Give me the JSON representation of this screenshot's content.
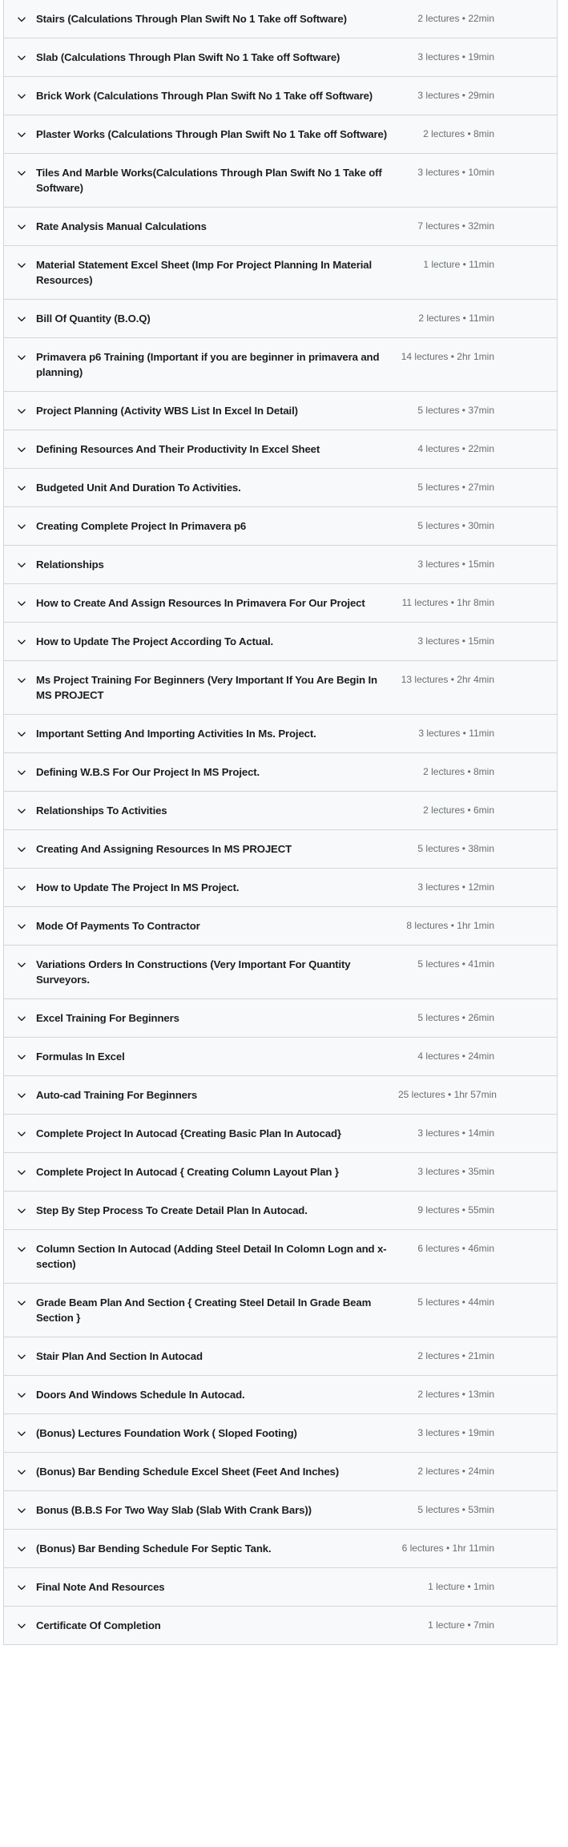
{
  "component": {
    "name": "course-curriculum-accordion",
    "colors": {
      "row_background": "#f7f9fa",
      "border": "#d1d7dc",
      "title_text": "#1c1d1f",
      "meta_text": "#6a6f73"
    },
    "chevron_icon": "chevron-down-icon"
  },
  "sections": [
    {
      "title": "Stairs (Calculations Through Plan Swift No 1 Take off Software)",
      "meta": "2 lectures • 22min"
    },
    {
      "title": "Slab (Calculations Through Plan Swift No 1 Take off Software)",
      "meta": "3 lectures • 19min"
    },
    {
      "title": "Brick Work (Calculations Through Plan Swift No 1 Take off Software)",
      "meta": "3 lectures • 29min"
    },
    {
      "title": "Plaster Works (Calculations Through Plan Swift No 1 Take off Software)",
      "meta": "2 lectures • 8min"
    },
    {
      "title": "Tiles And Marble Works(Calculations Through Plan Swift No 1 Take off Software)",
      "meta": "3 lectures • 10min"
    },
    {
      "title": "Rate Analysis Manual Calculations",
      "meta": "7 lectures • 32min"
    },
    {
      "title": "Material Statement Excel Sheet (Imp For Project Planning In Material Resources)",
      "meta": "1 lecture • 11min"
    },
    {
      "title": "Bill Of Quantity (B.O.Q)",
      "meta": "2 lectures • 11min"
    },
    {
      "title": "Primavera p6 Training (Important if you are beginner in primavera and planning)",
      "meta": "14 lectures • 2hr 1min"
    },
    {
      "title": "Project Planning (Activity WBS List In Excel In Detail)",
      "meta": "5 lectures • 37min"
    },
    {
      "title": "Defining Resources And Their Productivity In Excel Sheet",
      "meta": "4 lectures • 22min"
    },
    {
      "title": "Budgeted Unit And Duration To Activities.",
      "meta": "5 lectures • 27min"
    },
    {
      "title": "Creating Complete Project In Primavera p6",
      "meta": "5 lectures • 30min"
    },
    {
      "title": "Relationships",
      "meta": "3 lectures • 15min"
    },
    {
      "title": "How to Create And Assign Resources In Primavera For Our Project",
      "meta": "11 lectures • 1hr 8min"
    },
    {
      "title": "How to Update The Project According To Actual.",
      "meta": "3 lectures • 15min"
    },
    {
      "title": "Ms Project Training For Beginners (Very Important If You Are Begin In MS PROJECT",
      "meta": "13 lectures • 2hr 4min"
    },
    {
      "title": "Important Setting And Importing Activities In Ms. Project.",
      "meta": "3 lectures • 11min"
    },
    {
      "title": "Defining W.B.S For Our Project In MS Project.",
      "meta": "2 lectures • 8min"
    },
    {
      "title": "Relationships To Activities",
      "meta": "2 lectures • 6min"
    },
    {
      "title": "Creating And Assigning Resources In MS PROJECT",
      "meta": "5 lectures • 38min"
    },
    {
      "title": "How to Update The Project In MS Project.",
      "meta": "3 lectures • 12min"
    },
    {
      "title": "Mode Of Payments To Contractor",
      "meta": "8 lectures • 1hr 1min"
    },
    {
      "title": "Variations Orders In Constructions (Very Important For Quantity Surveyors.",
      "meta": "5 lectures • 41min"
    },
    {
      "title": "Excel Training For Beginners",
      "meta": "5 lectures • 26min"
    },
    {
      "title": "Formulas In Excel",
      "meta": "4 lectures • 24min"
    },
    {
      "title": "Auto-cad Training For Beginners",
      "meta": "25 lectures • 1hr 57min"
    },
    {
      "title": "Complete Project In Autocad {Creating Basic Plan In Autocad}",
      "meta": "3 lectures • 14min"
    },
    {
      "title": "Complete Project In Autocad { Creating Column Layout Plan }",
      "meta": "3 lectures • 35min"
    },
    {
      "title": "Step By Step Process To Create Detail Plan In Autocad.",
      "meta": "9 lectures • 55min"
    },
    {
      "title": "Column Section In Autocad (Adding Steel Detail In Colomn Logn and x-section)",
      "meta": "6 lectures • 46min"
    },
    {
      "title": "Grade Beam Plan And Section { Creating Steel Detail In Grade Beam Section }",
      "meta": "5 lectures • 44min"
    },
    {
      "title": "Stair Plan And Section In Autocad",
      "meta": "2 lectures • 21min"
    },
    {
      "title": "Doors And Windows Schedule In Autocad.",
      "meta": "2 lectures • 13min"
    },
    {
      "title": "(Bonus) Lectures Foundation Work ( Sloped Footing)",
      "meta": "3 lectures • 19min"
    },
    {
      "title": "(Bonus) Bar Bending Schedule Excel Sheet (Feet And Inches)",
      "meta": "2 lectures • 24min"
    },
    {
      "title": "Bonus (B.B.S For Two Way Slab (Slab With Crank Bars))",
      "meta": "5 lectures • 53min"
    },
    {
      "title": "(Bonus) Bar Bending Schedule For Septic Tank.",
      "meta": "6 lectures • 1hr 11min"
    },
    {
      "title": "Final Note And Resources",
      "meta": "1 lecture • 1min"
    },
    {
      "title": "Certificate Of Completion",
      "meta": "1 lecture • 7min"
    }
  ]
}
